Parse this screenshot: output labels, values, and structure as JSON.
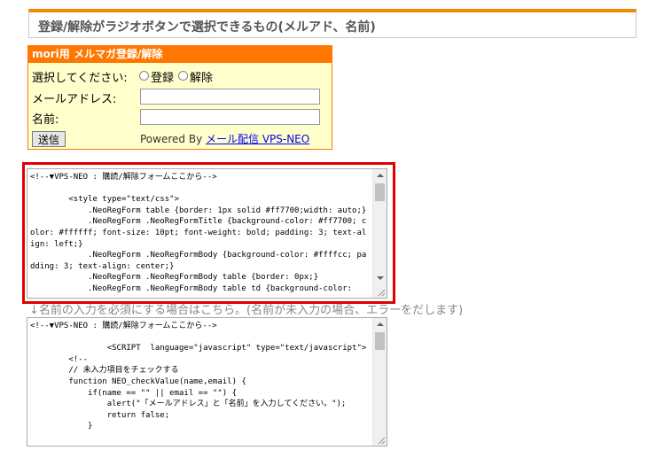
{
  "header": {
    "title": "登録/解除がラジオボタンで選択できるもの(メルアド、名前)"
  },
  "form": {
    "title": "mori用 メルマガ登録/解除",
    "select_label": "選択してください:",
    "option_register": "登録",
    "option_unregister": "解除",
    "email_label": "メールアドレス:",
    "email_value": "",
    "name_label": "名前:",
    "name_value": "",
    "submit_label": "送信",
    "powered_prefix": "Powered By",
    "powered_link": "メール配信 VPS-NEO"
  },
  "code1": {
    "text": "<!--▼VPS-NEO : 購読/解除フォームここから-->\n\n\t<style type=\"text/css\">\n\t    .NeoRegForm table {border: 1px solid #ff7700;width: auto;}\n\t    .NeoRegForm .NeoRegFormTitle {background-color: #ff7700; color: #ffffff; font-size: 10pt; font-weight: bold; padding: 3; text-align: left;}\n\t    .NeoRegForm .NeoRegFormBody {background-color: #ffffcc; padding: 3; text-align: center;}\n\t    .NeoRegForm .NeoRegFormBody table {border: 0px;}\n\t    .NeoRegForm .NeoRegFormBody table td {background-color:"
  },
  "note": {
    "text": "↓名前の入力を必須にする場合はこちら。(名前が未入力の場合、エラーをだします)"
  },
  "code2": {
    "text": "<!--▼VPS-NEO : 購読/解除フォームここから-->\n\n\t\t<SCRIPT  language=\"javascript\" type=\"text/javascript\">\n\t<!--\n\t// 未入力項目をチェックする\n\tfunction NEO_checkValue(name,email) {\n\t    if(name == \"\" || email == \"\") {\n\t\talert(\"「メールアドレス」と「名前」を入力してください。\");\n\t\treturn false;\n\t    }"
  },
  "colors": {
    "accent": "#ff7700",
    "form_bg": "#ffffcc",
    "highlight": "#e00000"
  }
}
